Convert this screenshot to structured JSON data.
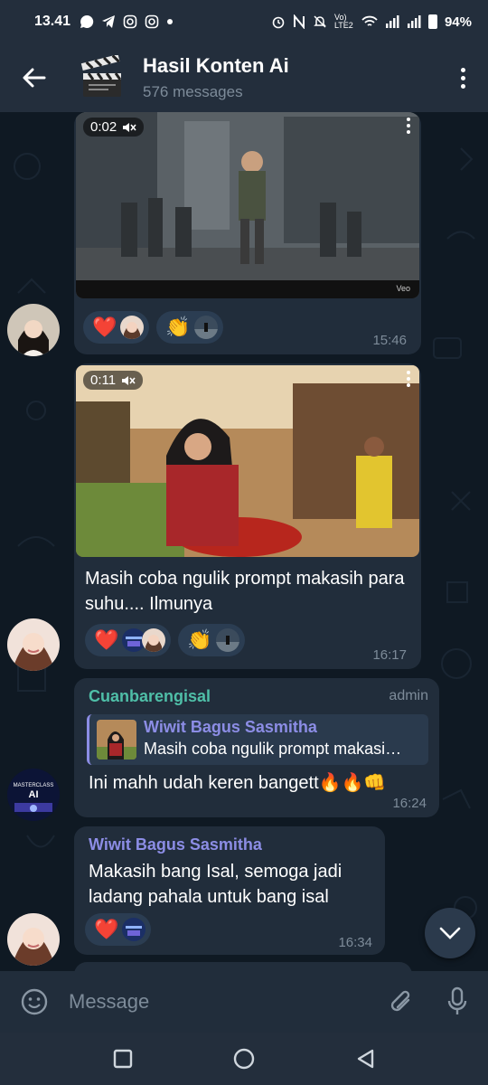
{
  "status_bar": {
    "time": "13.41",
    "network_label": "Vo) LTE2",
    "battery": "94%"
  },
  "header": {
    "back_icon": "arrow-left-icon",
    "title": "Hasil Konten Ai",
    "subtitle": "576 messages",
    "menu_icon": "more-vertical-icon"
  },
  "messages": [
    {
      "type": "video",
      "duration": "0:02",
      "muted": true,
      "watermark": "Veo",
      "reactions": [
        {
          "emoji": "❤️",
          "users": 1
        },
        {
          "emoji": "👏",
          "users": 1
        }
      ],
      "time": "15:46"
    },
    {
      "type": "video",
      "duration": "0:11",
      "muted": true,
      "caption": "Masih coba ngulik prompt makasih para suhu.... Ilmunya",
      "reactions": [
        {
          "emoji": "❤️",
          "users": 2
        },
        {
          "emoji": "👏",
          "users": 1
        }
      ],
      "time": "16:17"
    },
    {
      "type": "text",
      "sender": "Cuanbarengisal",
      "sender_color": "#4fbfa8",
      "role": "admin",
      "reply_to": {
        "sender": "Wiwit Bagus Sasmitha",
        "text": "Masih coba ngulik prompt makasi…"
      },
      "text": "Ini mahh udah keren bangett🔥🔥👊",
      "time": "16:24",
      "avatar_text": "MASTERCLASS AI"
    },
    {
      "type": "text",
      "sender": "Wiwit Bagus Sasmitha",
      "sender_color": "#8c8de5",
      "text": "Makasih bang Isal, semoga jadi ladang pahala untuk bang isal",
      "reactions": [
        {
          "emoji": "❤️",
          "users": 1
        }
      ],
      "time": "16:34"
    }
  ],
  "input": {
    "placeholder": "Message",
    "emoji_icon": "smile-icon",
    "attach_icon": "paperclip-icon",
    "mic_icon": "microphone-icon"
  },
  "colors": {
    "header_bg": "#232e3c",
    "chat_bg": "#0f1923",
    "bubble_bg": "#212d3b",
    "accent_green": "#4fbfa8",
    "accent_purple": "#8c8de5"
  }
}
